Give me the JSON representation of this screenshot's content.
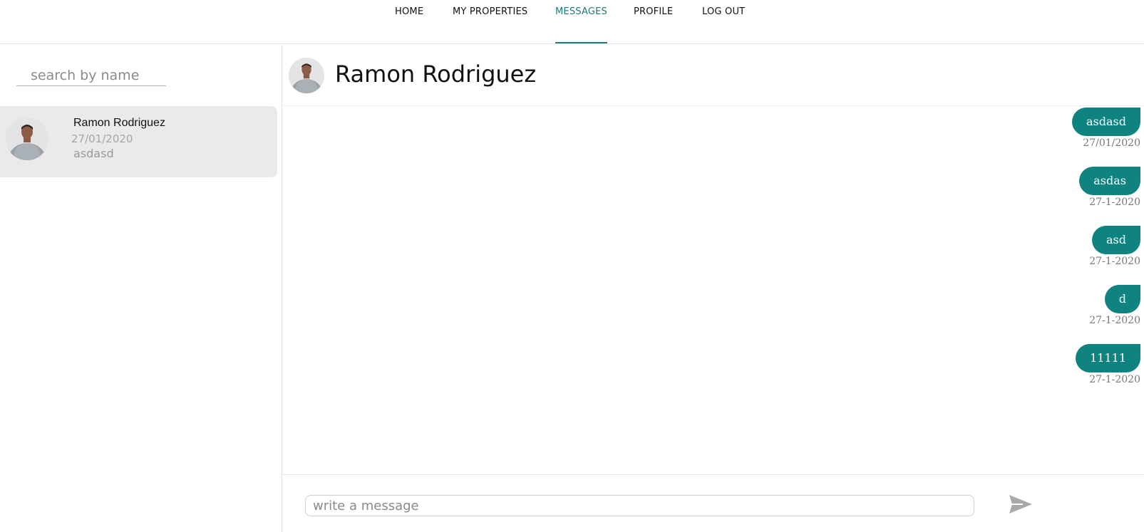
{
  "nav": {
    "items": [
      {
        "label": "HOME"
      },
      {
        "label": "MY PROPERTIES"
      },
      {
        "label": "MESSAGES"
      },
      {
        "label": "PROFILE"
      },
      {
        "label": "LOG OUT"
      }
    ],
    "active": "MESSAGES",
    "accent_color": "#1f7a7a"
  },
  "sidebar": {
    "search": {
      "placeholder": "search by name",
      "value": ""
    },
    "contacts": [
      {
        "name": "Ramon Rodriguez",
        "date": "27/01/2020",
        "preview": "asdasd",
        "avatar_icon": "user-photo"
      }
    ]
  },
  "chat": {
    "title": "Ramon Rodriguez",
    "avatar_icon": "user-photo",
    "bubble_color": "#0e8380",
    "messages": [
      {
        "text": "asdasd",
        "time": "27/01/2020"
      },
      {
        "text": "asdas",
        "time": "27-1-2020"
      },
      {
        "text": "asd",
        "time": "27-1-2020"
      },
      {
        "text": "d",
        "time": "27-1-2020"
      },
      {
        "text": "11111",
        "time": "27-1-2020"
      }
    ],
    "composer": {
      "placeholder": "write a message",
      "value": "",
      "send_icon": "send-icon"
    }
  }
}
